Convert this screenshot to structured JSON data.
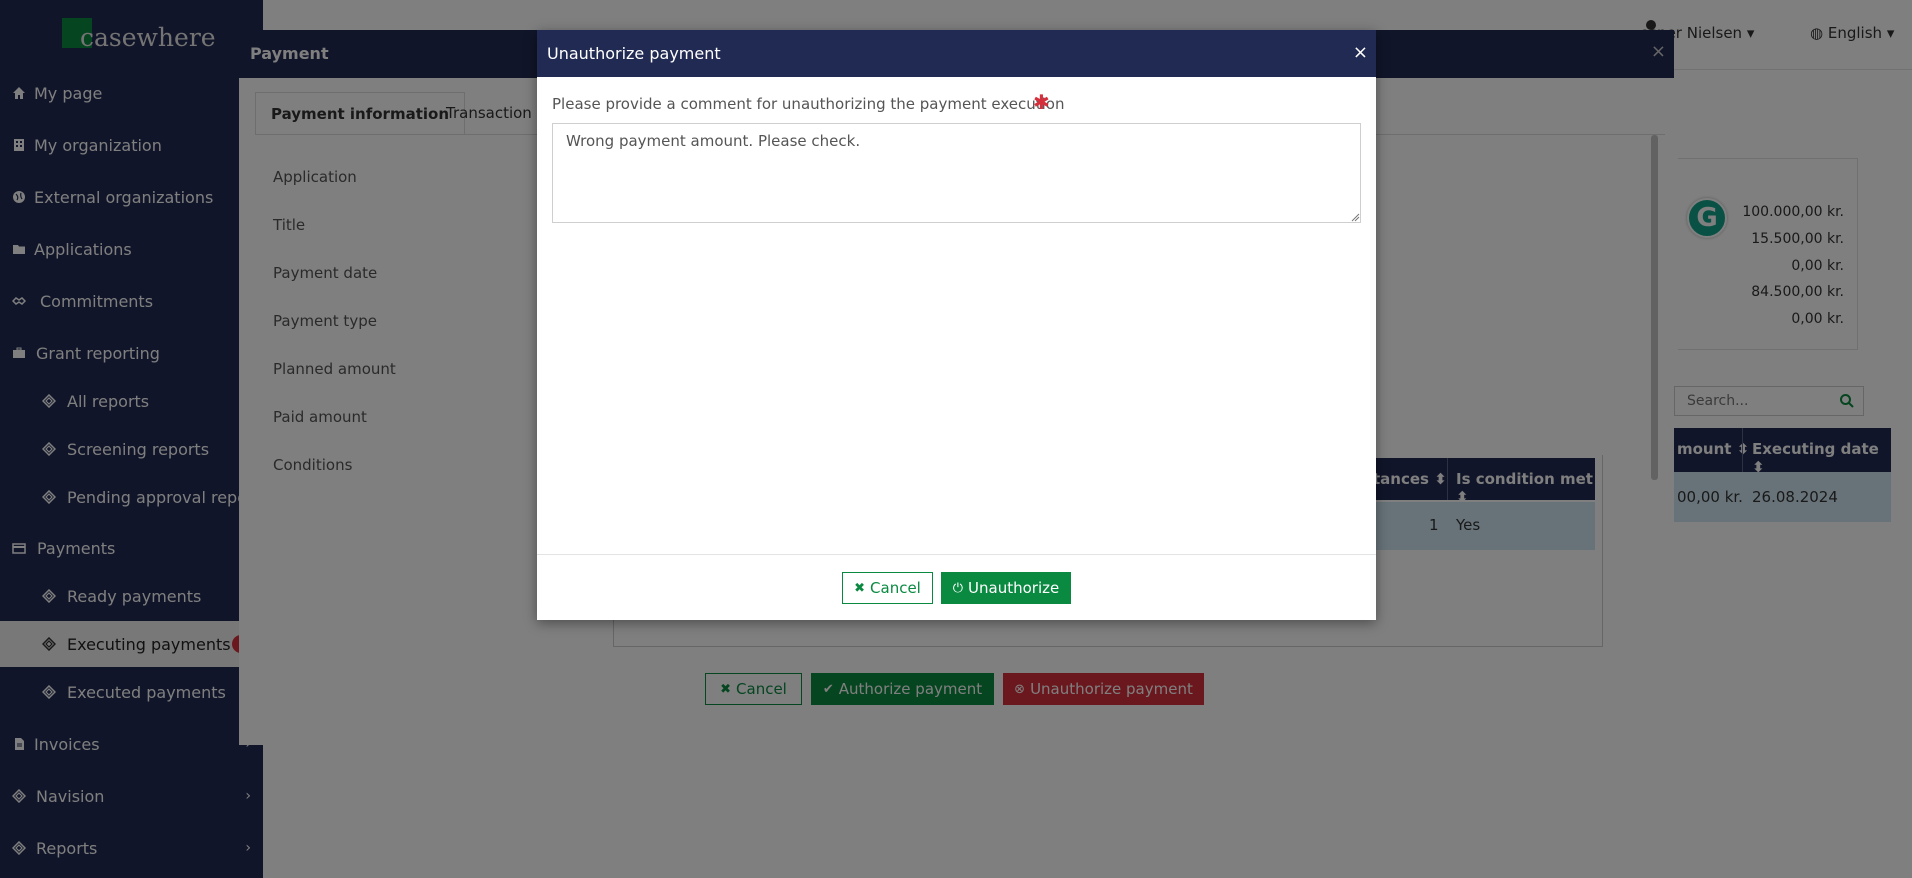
{
  "app": {
    "logo_text": "casewhere",
    "user_name": "esper Nielsen",
    "language": "English"
  },
  "sidebar": {
    "items": [
      {
        "label": "My page",
        "icon": "home-icon"
      },
      {
        "label": "My organization",
        "icon": "building-icon"
      },
      {
        "label": "External organizations",
        "icon": "globe-icon"
      },
      {
        "label": "Applications",
        "icon": "folder-icon"
      },
      {
        "label": "Commitments",
        "icon": "handshake-icon"
      },
      {
        "label": "Grant reporting",
        "icon": "briefcase-icon"
      },
      {
        "label": "All reports",
        "icon": "cube-icon"
      },
      {
        "label": "Screening reports",
        "icon": "cube-icon"
      },
      {
        "label": "Pending approval reports",
        "icon": "cube-icon"
      },
      {
        "label": "Payments",
        "icon": "credit-card-icon"
      },
      {
        "label": "Ready payments",
        "icon": "cube-icon"
      },
      {
        "label": "Executing payments",
        "icon": "cube-icon"
      },
      {
        "label": "Executed payments",
        "icon": "cube-icon"
      },
      {
        "label": "Invoices",
        "icon": "file-icon"
      },
      {
        "label": "Navision",
        "icon": "cube-icon"
      },
      {
        "label": "Reports",
        "icon": "cube-icon"
      }
    ]
  },
  "payment_panel": {
    "title": "Payment",
    "tabs": [
      "Payment information",
      "Transaction"
    ],
    "field_labels": [
      "Application",
      "Title",
      "Payment date",
      "Payment type",
      "Planned amount",
      "Paid amount",
      "Conditions"
    ],
    "amounts": [
      "100.000,00 kr.",
      "15.500,00 kr.",
      "0,00 kr.",
      "84.500,00 kr.",
      "0,00 kr."
    ],
    "search_placeholder": "Search...",
    "right_table": {
      "headers": [
        "mount",
        "Executing date"
      ],
      "row": [
        "00,00 kr.",
        "26.08.2024"
      ]
    },
    "conditions_table": {
      "headers": [
        "tances",
        "Is condition met"
      ],
      "row": [
        "1",
        "Yes"
      ]
    },
    "buttons": {
      "cancel": "Cancel",
      "authorize": "Authorize payment",
      "unauthorize": "Unauthorize payment"
    }
  },
  "modal": {
    "title": "Unauthorize payment",
    "close": "×",
    "comment_label": "Please provide a comment for unauthorizing the payment execution",
    "required_marker": "✱",
    "comment_value": "Wrong payment amount. Please check.",
    "cancel_label": "Cancel",
    "unauthorize_label": "Unauthorize"
  },
  "colors": {
    "navy": "#212a52",
    "green": "#0a8a41",
    "red": "#d62f3c",
    "highlight_row": "#cfe6f2"
  }
}
